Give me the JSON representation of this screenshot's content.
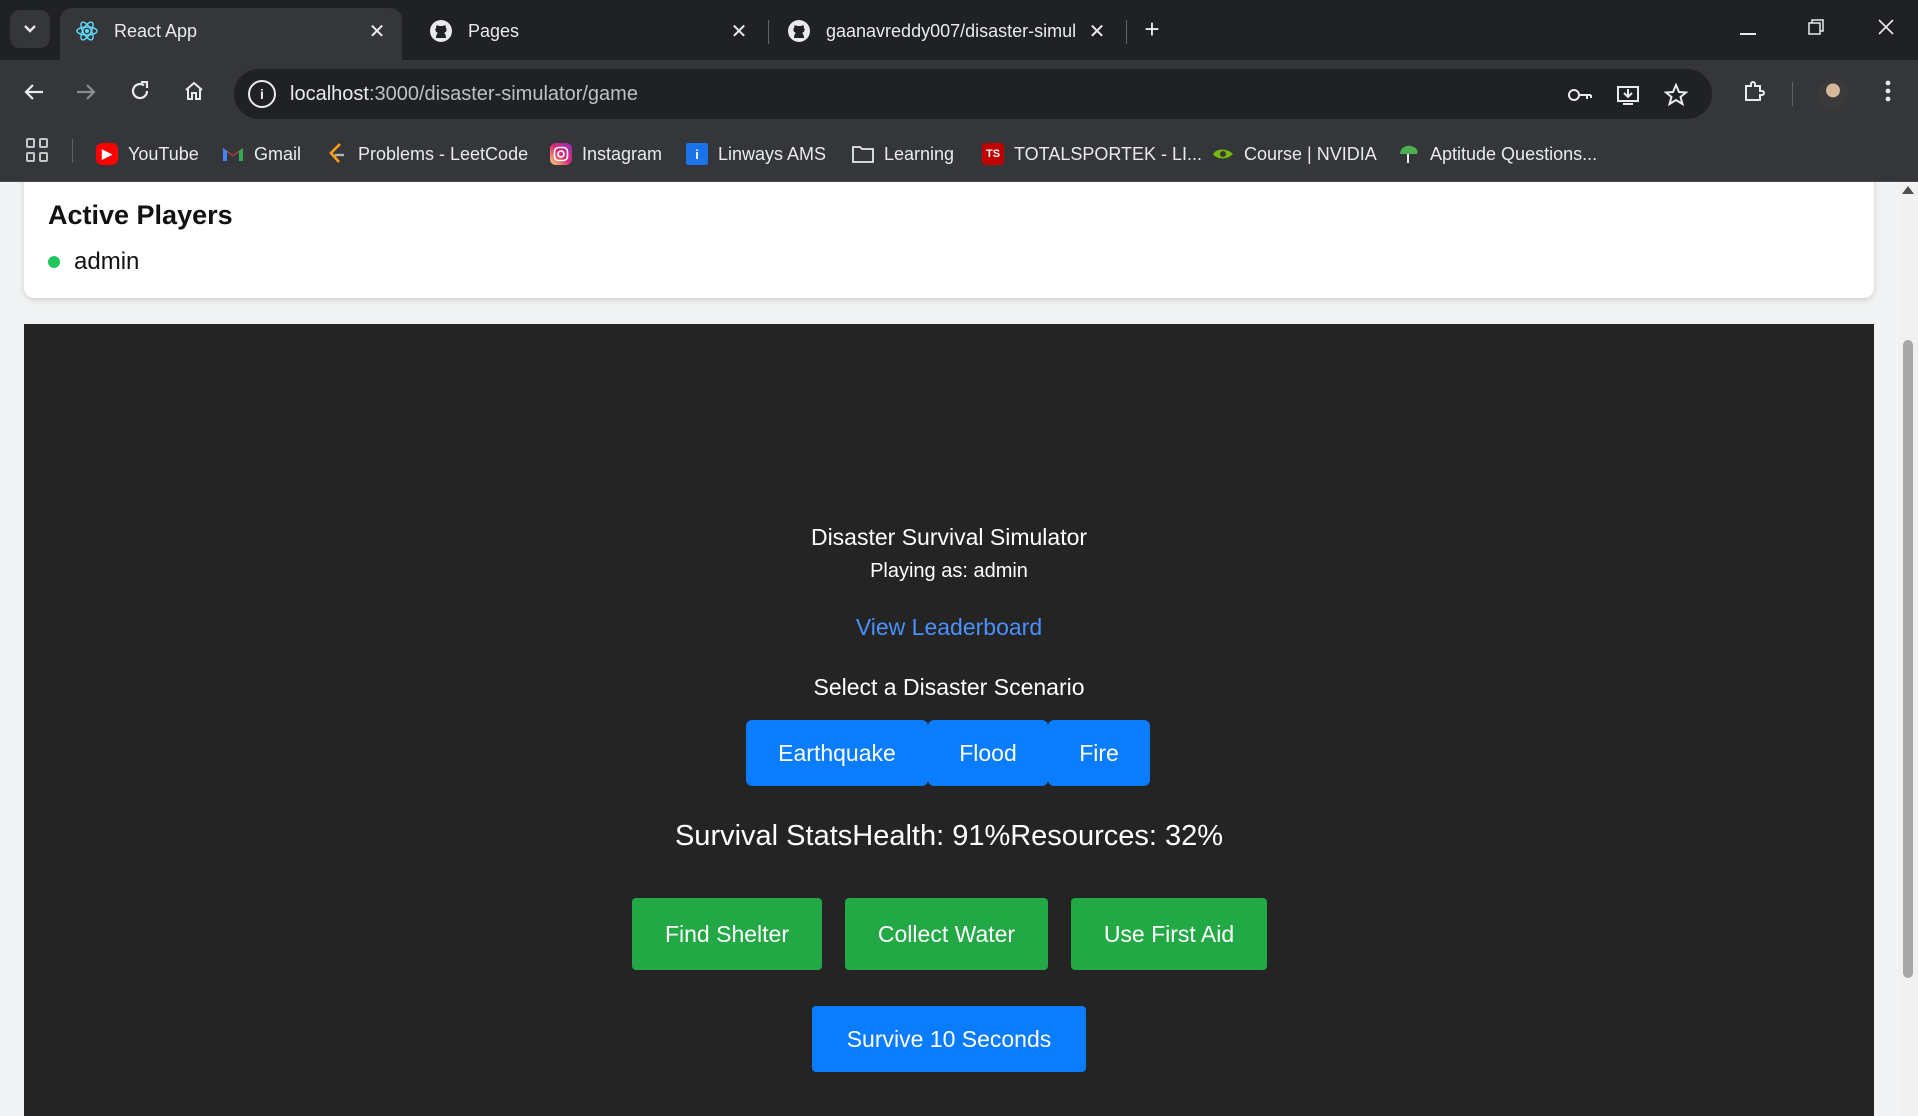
{
  "browser": {
    "tabs": [
      {
        "title": "React App",
        "icon": "react-icon",
        "active": true
      },
      {
        "title": "Pages",
        "icon": "github-icon",
        "active": false
      },
      {
        "title": "gaanavreddy007/disaster-simul",
        "icon": "github-icon",
        "active": false
      }
    ],
    "url_host": "localhost",
    "url_rest": ":3000/disaster-simulator/game",
    "bookmarks": [
      {
        "label": "YouTube",
        "icon": "youtube-icon",
        "color": "#ff0000"
      },
      {
        "label": "Gmail",
        "icon": "gmail-icon",
        "color": "#ea4335"
      },
      {
        "label": "Problems - LeetCode",
        "icon": "leetcode-icon",
        "color": "#ffa116"
      },
      {
        "label": "Instagram",
        "icon": "instagram-icon",
        "color": "#d62976"
      },
      {
        "label": "Linways AMS",
        "icon": "linways-icon",
        "color": "#1a73e8"
      },
      {
        "label": "Learning",
        "icon": "folder-icon",
        "color": "#e8eaed"
      },
      {
        "label": "TOTALSPORTEK - LI...",
        "icon": "totalsportek-icon",
        "color": "#c00000"
      },
      {
        "label": "Course | NVIDIA",
        "icon": "nvidia-icon",
        "color": "#76b900"
      },
      {
        "label": "Aptitude Questions...",
        "icon": "aptitude-icon",
        "color": "#4caf50"
      }
    ]
  },
  "players": {
    "title": "Active Players",
    "list": [
      "admin"
    ]
  },
  "game": {
    "title": "Disaster Survival Simulator",
    "playing_as": "Playing as: admin",
    "leaderboard_link": "View Leaderboard",
    "scenario_label": "Select a Disaster Scenario",
    "scenarios": [
      "Earthquake",
      "Flood",
      "Fire"
    ],
    "stats_text": "Survival StatsHealth: 91%Resources: 32%",
    "actions": [
      "Find Shelter",
      "Collect Water",
      "Use First Aid"
    ],
    "survive_button": "Survive 10 Seconds"
  },
  "colors": {
    "panel_bg": "#242424",
    "primary_blue": "#0a7cff",
    "action_green": "#22a845",
    "link_blue": "#4a90ff",
    "online_green": "#22c55e"
  }
}
